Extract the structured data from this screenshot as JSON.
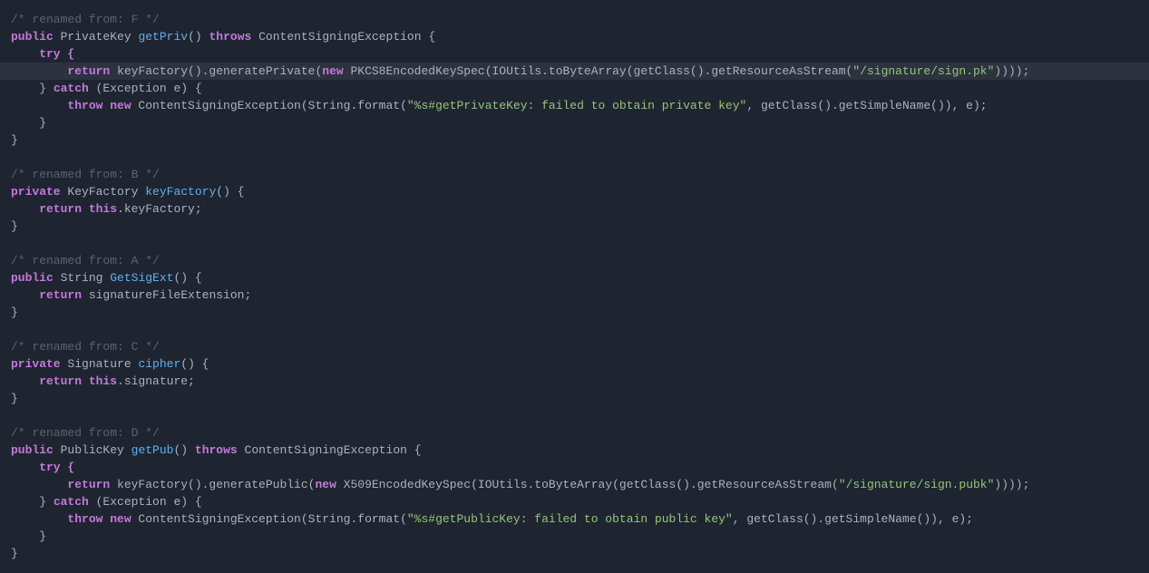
{
  "code": {
    "m1": {
      "comment": "/* renamed from: F */",
      "kw_public": "public",
      "type": "PrivateKey",
      "name": "getPriv",
      "parens": "()",
      "throws": "throws",
      "exType": "ContentSigningException",
      "brace_open": " {",
      "try_line": "    try {",
      "ret_kw": "        return",
      "ret_call1": " keyFactory().generatePrivate(",
      "new_kw": "new",
      "ret_call2": " PKCS8EncodedKeySpec(IOUtils.toByteArray(getClass().getResourceAsStream(",
      "ret_str": "\"/signature/sign.pk\"",
      "ret_tail": "))));",
      "catch_kw1": "    } ",
      "catch_kw2": "catch",
      "catch_paren": " (Exception e) {",
      "throw_kw": "        throw new",
      "throw_call1": " ContentSigningException(String.format(",
      "throw_str": "\"%s#getPrivateKey: failed to obtain private key\"",
      "throw_tail": ", getClass().getSimpleName()), e);",
      "close1": "    }",
      "close2": "}"
    },
    "m2": {
      "comment": "/* renamed from: B */",
      "kw_private": "private",
      "type": "KeyFactory",
      "name": "keyFactory",
      "parens": "()",
      "brace_open": " {",
      "ret_kw": "    return",
      "this_kw": " this",
      "ret_tail": ".keyFactory;",
      "close": "}"
    },
    "m3": {
      "comment": "/* renamed from: A */",
      "kw_public": "public",
      "type": "String",
      "name": "GetSigExt",
      "parens": "()",
      "brace_open": " {",
      "ret_kw": "    return",
      "ret_tail": " signatureFileExtension;",
      "close": "}"
    },
    "m4": {
      "comment": "/* renamed from: C */",
      "kw_private": "private",
      "type": "Signature",
      "name": "cipher",
      "parens": "()",
      "brace_open": " {",
      "ret_kw": "    return",
      "this_kw": " this",
      "ret_tail": ".signature;",
      "close": "}"
    },
    "m5": {
      "comment": "/* renamed from: D */",
      "kw_public": "public",
      "type": "PublicKey",
      "name": "getPub",
      "parens": "()",
      "throws": "throws",
      "exType": "ContentSigningException",
      "brace_open": " {",
      "try_line": "    try {",
      "ret_kw": "        return",
      "ret_call1": " keyFactory().generatePublic(",
      "new_kw": "new",
      "ret_call2": " X509EncodedKeySpec(IOUtils.toByteArray(getClass().getResourceAsStream(",
      "ret_str": "\"/signature/sign.pubk\"",
      "ret_tail": "))));",
      "catch_kw1": "    } ",
      "catch_kw2": "catch",
      "catch_paren": " (Exception e) {",
      "throw_kw": "        throw new",
      "throw_call1": " ContentSigningException(String.format(",
      "throw_str": "\"%s#getPublicKey: failed to obtain public key\"",
      "throw_tail": ", getClass().getSimpleName()), e);",
      "close1": "    }",
      "close2": "}"
    }
  }
}
